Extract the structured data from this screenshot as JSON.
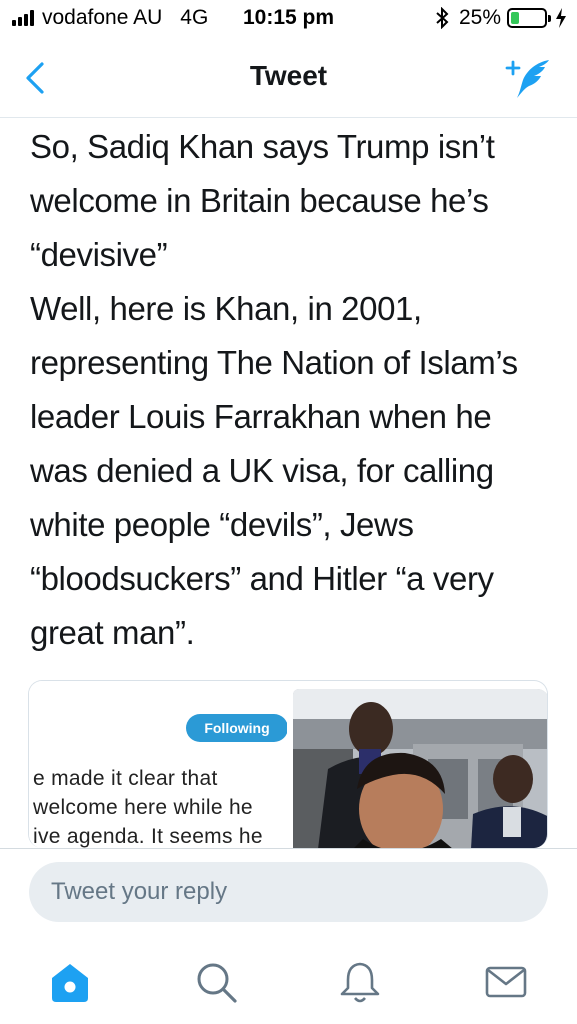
{
  "status_bar": {
    "carrier": "vodafone AU",
    "network": "4G",
    "time": "10:15 pm",
    "battery_percent": "25%",
    "battery_level": 0.25
  },
  "nav": {
    "title": "Tweet",
    "accent_color": "#1da1f2"
  },
  "tweet": {
    "text": "So, Sadiq Khan says Trump isn’t\nwelcome in Britain because he’s\n“devisive”\nWell, here is Khan, in 2001,\nrepresenting The Nation of Islam’s\nleader Louis Farrakhan when he\nwas denied a UK visa, for calling\nwhite people “devils”, Jews\n“bloodsuckers” and Hitler “a very\ngreat man”."
  },
  "quote_card": {
    "following_label": "Following",
    "lines": [
      "e made it clear that",
      "welcome here while he",
      "ive agenda. It seems he"
    ]
  },
  "reply": {
    "placeholder": "Tweet your reply"
  },
  "tabs": [
    {
      "icon": "home-icon",
      "active": true
    },
    {
      "icon": "search-icon",
      "active": false
    },
    {
      "icon": "bell-icon",
      "active": false
    },
    {
      "icon": "mail-icon",
      "active": false
    }
  ]
}
